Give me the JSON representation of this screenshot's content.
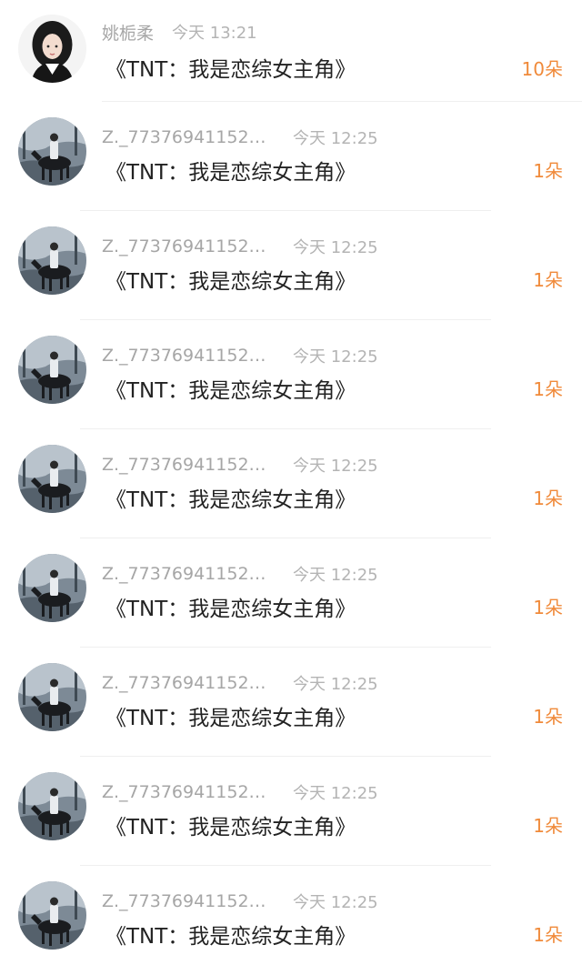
{
  "items": [
    {
      "username": "姚栀柔",
      "time": "今天 13:21",
      "title": "《TNT：我是恋综女主角》",
      "amount": "10朵",
      "avatar": "girl-portrait-avatar"
    },
    {
      "username": "Z._773769411528...",
      "time": "今天 12:25",
      "title": "《TNT：我是恋综女主角》",
      "amount": "1朵",
      "avatar": "rider-on-horse-avatar"
    },
    {
      "username": "Z._773769411528...",
      "time": "今天 12:25",
      "title": "《TNT：我是恋综女主角》",
      "amount": "1朵",
      "avatar": "rider-on-horse-avatar"
    },
    {
      "username": "Z._773769411528...",
      "time": "今天 12:25",
      "title": "《TNT：我是恋综女主角》",
      "amount": "1朵",
      "avatar": "rider-on-horse-avatar"
    },
    {
      "username": "Z._773769411528...",
      "time": "今天 12:25",
      "title": "《TNT：我是恋综女主角》",
      "amount": "1朵",
      "avatar": "rider-on-horse-avatar"
    },
    {
      "username": "Z._773769411528...",
      "time": "今天 12:25",
      "title": "《TNT：我是恋综女主角》",
      "amount": "1朵",
      "avatar": "rider-on-horse-avatar"
    },
    {
      "username": "Z._773769411528...",
      "time": "今天 12:25",
      "title": "《TNT：我是恋综女主角》",
      "amount": "1朵",
      "avatar": "rider-on-horse-avatar"
    },
    {
      "username": "Z._773769411528...",
      "time": "今天 12:25",
      "title": "《TNT：我是恋综女主角》",
      "amount": "1朵",
      "avatar": "rider-on-horse-avatar"
    },
    {
      "username": "Z._773769411528...",
      "time": "今天 12:25",
      "title": "《TNT：我是恋综女主角》",
      "amount": "1朵",
      "avatar": "rider-on-horse-avatar"
    }
  ],
  "colors": {
    "amount": "#f08a3a",
    "username": "#a6a6a6",
    "title": "#222222"
  }
}
